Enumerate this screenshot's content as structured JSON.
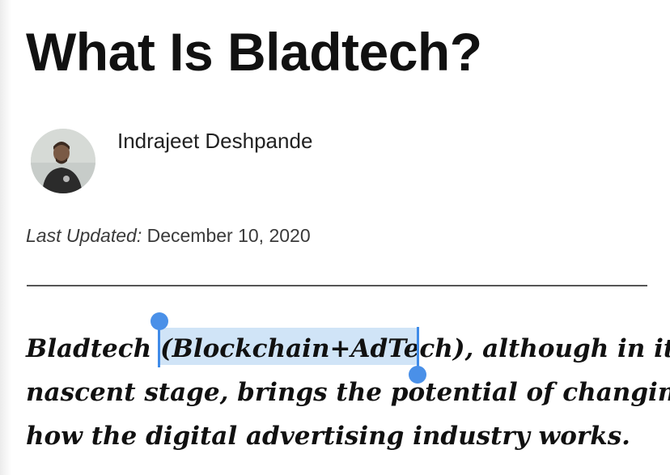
{
  "article": {
    "title": "What Is Bladtech?",
    "author": {
      "name": "Indrajeet Deshpande",
      "avatar_icon": "author-photo"
    },
    "updated": {
      "label": "Last Updated:",
      "date": "December 10, 2020"
    },
    "lead_lines": [
      "Bladtech (Blockchain+AdTech), although in its",
      "nascent stage, brings the potential of changing",
      "how the digital advertising industry works."
    ]
  },
  "selection": {
    "selected_text": "Blockchain+AdTech",
    "highlight_color": "#cfe2f7",
    "handle_color": "#4a90e8"
  }
}
